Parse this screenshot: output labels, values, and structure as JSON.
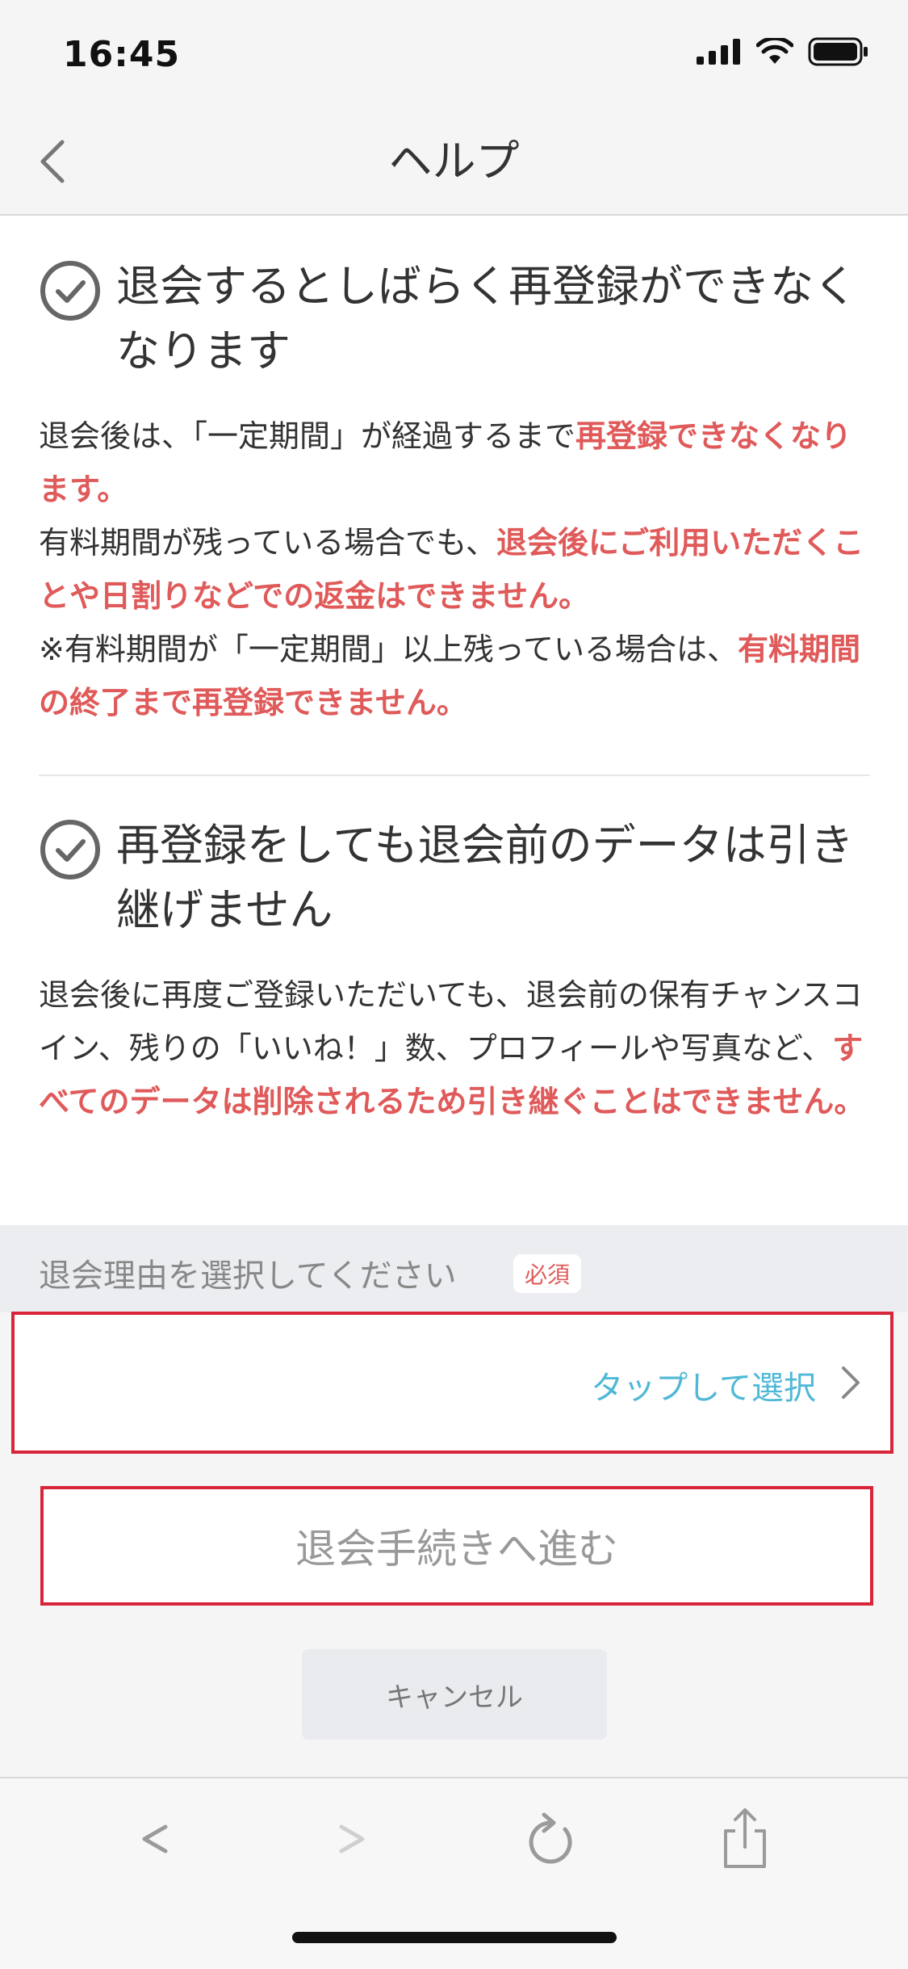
{
  "status": {
    "time": "16:45"
  },
  "nav": {
    "title": "ヘルプ"
  },
  "section1": {
    "heading": "退会するとしばらく再登録ができなくなります",
    "p1_normal": "退会後は、「一定期間」が経過するまで",
    "p1_em": "再登録できなくなります。",
    "p2_normal": "有料期間が残っている場合でも、",
    "p2_em": "退会後にご利用いただくことや日割りなどでの返金はできません。",
    "p3_normal": "※有料期間が「一定期間」以上残っている場合は、",
    "p3_em": "有料期間の終了まで再登録できません。"
  },
  "section2": {
    "heading": "再登録をしても退会前のデータは引き継げません",
    "p1_normal": "退会後に再度ご登録いただいても、退会前の保有チャンスコイン、残りの「いいね！」数、プロフィールや写真など、",
    "p1_em": "すべてのデータは削除されるため引き継ぐことはできません。"
  },
  "reason": {
    "label": "退会理由を選択してください",
    "required": "必須",
    "select_text": "タップして選択"
  },
  "buttons": {
    "proceed": "退会手続きへ進む",
    "cancel": "キャンセル"
  },
  "colors": {
    "emphasis": "#e05a5a",
    "link": "#4fb8d6",
    "highlight_border": "#d9253a"
  }
}
